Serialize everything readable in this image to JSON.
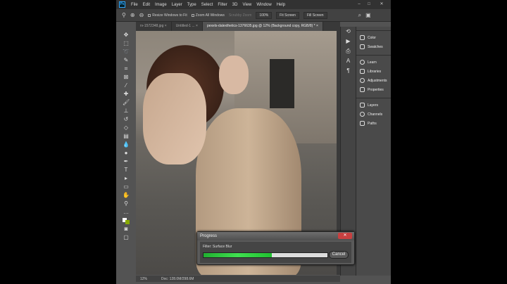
{
  "app": {
    "logo": "Ps"
  },
  "menu": [
    "File",
    "Edit",
    "Image",
    "Layer",
    "Type",
    "Select",
    "Filter",
    "3D",
    "View",
    "Window",
    "Help"
  ],
  "window_controls": {
    "minimize": "–",
    "maximize": "□",
    "close": "✕"
  },
  "options": {
    "resize_windows": "Resize Windows to Fit",
    "zoom_all": "Zoom All Windows",
    "scrubby_zoom": "Scrubby Zoom",
    "zoom_pct": "100%",
    "fit_screen": "Fit Screen",
    "fill_screen": "Fill Screen"
  },
  "tabs": [
    {
      "label": "rv-1572348.jpg ×"
    },
    {
      "label": "Untitled-1 ... ×"
    },
    {
      "label": "pexels-dalexthetics-1376635.jpg @ 12% (Background copy, RGB/8) * ×"
    }
  ],
  "panels": [
    {
      "label": "Color"
    },
    {
      "label": "Swatches"
    },
    {
      "label": "Learn"
    },
    {
      "label": "Libraries"
    },
    {
      "label": "Adjustments"
    },
    {
      "label": "Properties"
    },
    {
      "label": "Layers"
    },
    {
      "label": "Channels"
    },
    {
      "label": "Paths"
    }
  ],
  "status": {
    "zoom": "12%",
    "doc": "Doc: 128.0M/298.6M"
  },
  "progress": {
    "title": "Progress",
    "close": "✕",
    "label": "Filter: Surface Blur",
    "percent": 55,
    "cancel": "Cancel"
  }
}
